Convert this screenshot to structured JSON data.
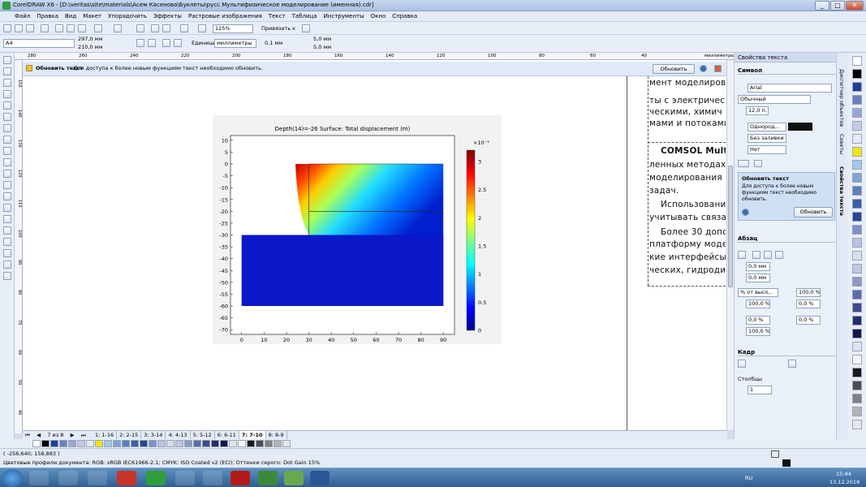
{
  "window": {
    "title": "CorelDRAW X6 - [D:\\veritas\\site\\materials\\Асем Касенова\\Буклеты\\руcс Мультифизическое моделирование (именная).cdr]",
    "controls": [
      "_",
      "□",
      "✕"
    ]
  },
  "menu": [
    "Файл",
    "Правка",
    "Вид",
    "Макет",
    "Упорядочить",
    "Эффекты",
    "Растровые изображения",
    "Текст",
    "Таблица",
    "Инструменты",
    "Окно",
    "Справка"
  ],
  "toolbar": {
    "zoom": "125%",
    "snap": "Привязать к"
  },
  "propbar": {
    "paper": "A4",
    "width": "297,0 мм",
    "height": "210,0 мм",
    "units_label": "Единицы:",
    "units": "миллиметры",
    "nudge": "0,1 мм",
    "dup_x": "5,0 мм",
    "dup_y": "5,0 мм"
  },
  "ruler": {
    "h_ticks": [
      "280",
      "260",
      "240",
      "220",
      "200",
      "180",
      "160",
      "140",
      "120",
      "100",
      "80",
      "60",
      "40"
    ],
    "unit": "миллиметры",
    "v_ticks": [
      "150",
      "140",
      "130",
      "120",
      "110",
      "100",
      "90",
      "80",
      "70",
      "60",
      "50",
      "40"
    ]
  },
  "notice": {
    "title": "Обновить текст",
    "text": " - Для доступа к более новым функциям текст необходимо обновить.",
    "button": "Обновить"
  },
  "textframe": {
    "lines": [
      "мент моделирова",
      "ты с электричес",
      "ческими, химич",
      "мами и потоками",
      "",
      "COMSOL Mult",
      "ленных методах",
      "моделирования и",
      "задач.",
      "Использовани",
      "учитывать связан",
      "Более 30 допо",
      "платформу моделі",
      "кие интерфейсы",
      "ческих, гидродин"
    ]
  },
  "docker": {
    "title": "Свойства текста",
    "symbol_section": "Символ",
    "font": "Arial",
    "style": "Обычный",
    "size": "12,0 п.",
    "fill": "Однород...",
    "bg": "Без заливки",
    "outline": "Нет",
    "update_title": "Обновить текст",
    "update_text": "Для доступа к более новым функциям текст необходимо обновить.",
    "update_btn": "Обновить",
    "para_section": "Абзац",
    "indent1": "0,0 мм",
    "indent2": "0,0 мм",
    "spacing_mode": "% от высо...",
    "spacing1": "100,0 %",
    "spacing2": "100,0 %",
    "spacing3": "0,0 %",
    "spacing4": "0,0 %",
    "spacing5": "0,0 %",
    "spacing6": "100,0 %",
    "frame_section": "Кадр",
    "columns_label": "Столбцы",
    "columns": "1"
  },
  "sidetabs": [
    "Диспетчер объектов",
    "Советы",
    "Свойства текста"
  ],
  "pagetabs": {
    "counter": "7 из 8",
    "tabs": [
      "1: 1-16",
      "2: 2-15",
      "3: 3-14",
      "4: 4-13",
      "5: 5-12",
      "6: 6-11",
      "7: 7-10",
      "8: 8-9"
    ],
    "active": 6
  },
  "status": {
    "coords": "( -256,640; 158,883 )",
    "profiles": "Цветовые профили документа: RGB: sRGB IEC61966-2.1; CMYK: ISO Coated v2 (ECI); Оттенки серого: Dot Gain 15%"
  },
  "taskbar": {
    "lang": "RU",
    "time": "15:44",
    "date": "13.12.2018"
  },
  "chart_data": {
    "type": "heatmap",
    "title": "Depth(14)=-26   Surface: Total displacement (m)",
    "xlim": [
      -5,
      95
    ],
    "ylim": [
      -72,
      12
    ],
    "xticks": [
      "0",
      "10",
      "20",
      "30",
      "40",
      "50",
      "60",
      "70",
      "80",
      "90"
    ],
    "yticks": [
      "10",
      "5",
      "0",
      "-5",
      "-10",
      "-15",
      "-20",
      "-25",
      "-30",
      "-35",
      "-40",
      "-45",
      "-50",
      "-55",
      "-60",
      "-65",
      "-70"
    ],
    "colorbar": {
      "exponent": "×10⁻³",
      "ticks": [
        "3",
        "2.5",
        "2",
        "1.5",
        "1",
        "0.5",
        "0"
      ],
      "range": [
        0,
        3.2
      ]
    }
  },
  "colors": {
    "accent": "#3a6fb5",
    "palette": [
      "#ffffff",
      "#000000",
      "#1f3f9c",
      "#6a7fc2",
      "#9aa6d6",
      "#c6cbe6",
      "#e7e8f3",
      "#f2e600",
      "#a6c7e8",
      "#7fa3d1",
      "#5a7fbf",
      "#3b5ea8",
      "#2a4592",
      "#7b8fc9",
      "#b9c3e2",
      "#d9deef",
      "#c2c7de",
      "#8d98c4",
      "#5f6cab",
      "#3d4a8f",
      "#242d6e",
      "#14194d",
      "#e0e3f0",
      "#f5f6fa",
      "#1a1a1a",
      "#4d4d4d",
      "#808080",
      "#b3b3b3",
      "#e6e6e6"
    ]
  }
}
